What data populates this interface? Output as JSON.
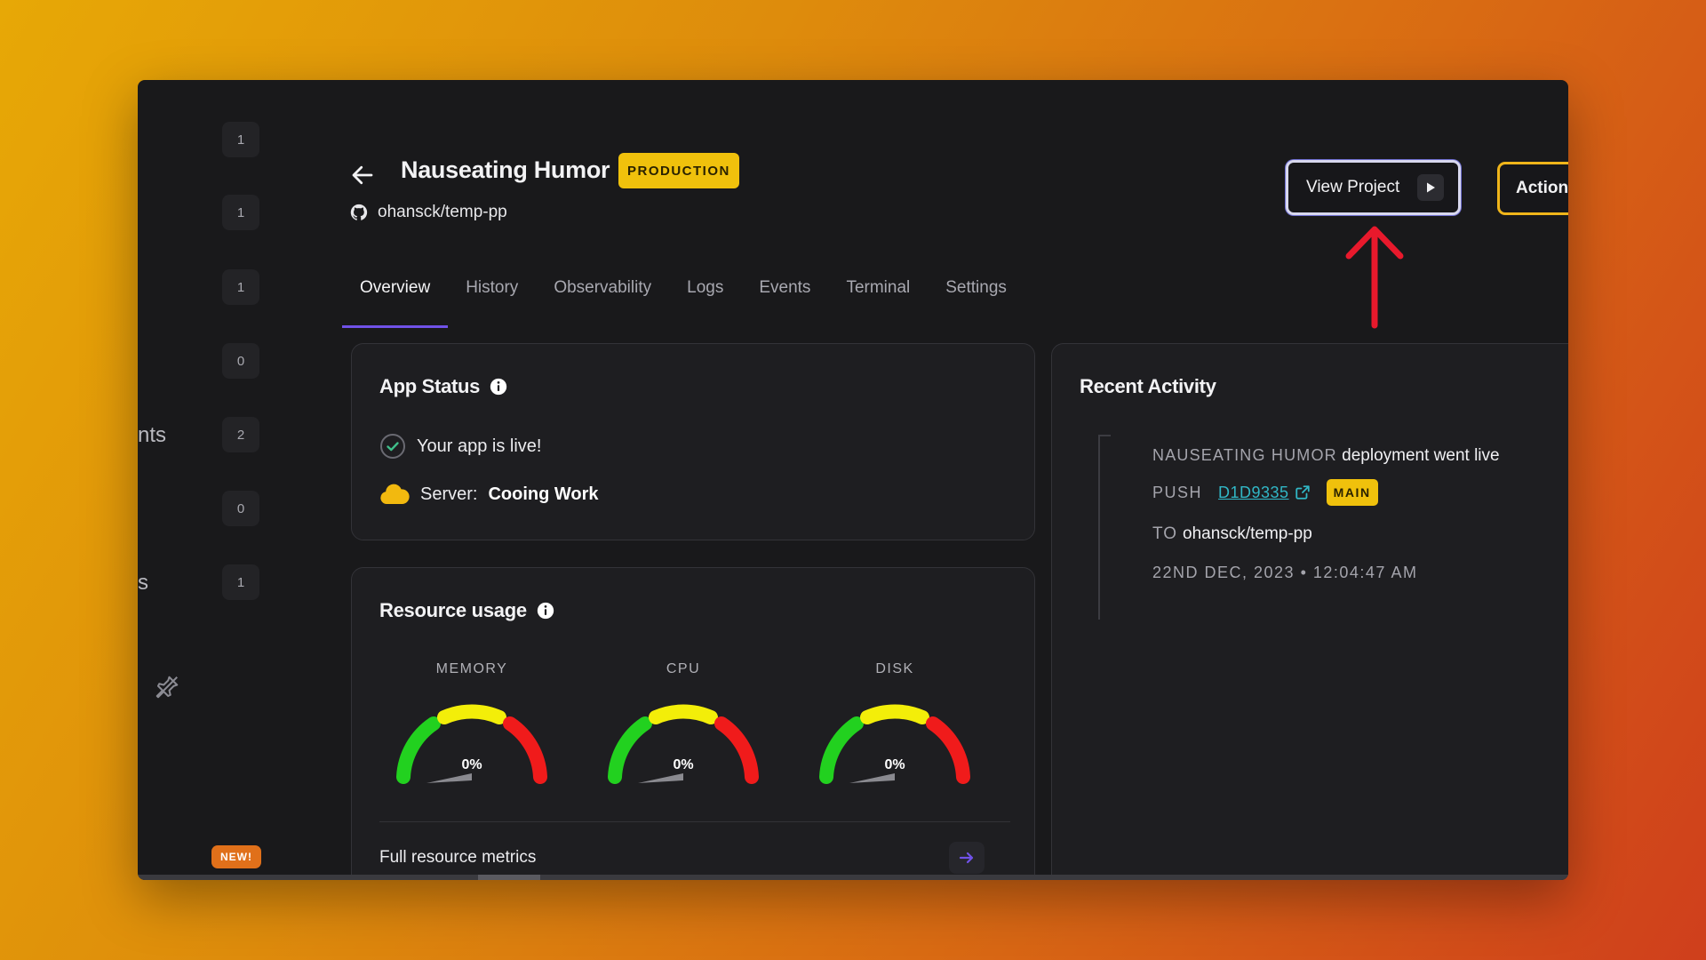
{
  "sidebar": {
    "fragments": [
      "nts",
      "s"
    ],
    "counts": [
      "1",
      "1",
      "1",
      "0",
      "2",
      "0",
      "1"
    ],
    "new_badge": "NEW!"
  },
  "header": {
    "title": "Nauseating Humor",
    "env_badge": "PRODUCTION",
    "repo": "ohansck/temp-pp",
    "view_project_label": "View Project",
    "actions_label": "Actions"
  },
  "tabs": [
    {
      "label": "Overview",
      "active": true
    },
    {
      "label": "History"
    },
    {
      "label": "Observability"
    },
    {
      "label": "Logs"
    },
    {
      "label": "Events"
    },
    {
      "label": "Terminal"
    },
    {
      "label": "Settings"
    }
  ],
  "app_status": {
    "title": "App Status",
    "live_text": "Your app is live!",
    "server_label": "Server:",
    "server_name": "Cooing Work"
  },
  "resource_usage": {
    "title": "Resource usage",
    "gauges": [
      {
        "label": "MEMORY",
        "value": "0%"
      },
      {
        "label": "CPU",
        "value": "0%"
      },
      {
        "label": "DISK",
        "value": "0%"
      }
    ],
    "full_metrics_label": "Full resource metrics"
  },
  "recent_activity": {
    "title": "Recent Activity",
    "app_name": "NAUSEATING HUMOR",
    "event_text": "deployment went live",
    "push_label": "PUSH",
    "commit": "D1D9335",
    "branch": "MAIN",
    "to_label": "TO",
    "to_repo": "ohansck/temp-pp",
    "timestamp": "22ND DEC, 2023 • 12:04:47 AM"
  },
  "colors": {
    "accent": "#7052e8",
    "production_badge": "#f0c10c",
    "actions_border": "#f0b51a",
    "link": "#31b7c6",
    "annotation_arrow": "#e8192c"
  }
}
